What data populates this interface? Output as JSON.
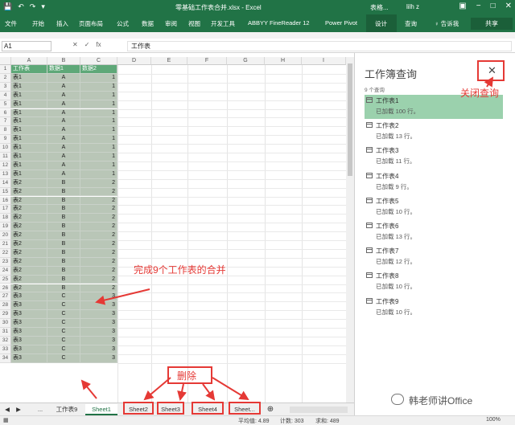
{
  "titlebar": {
    "qat": [
      "💾",
      "↶",
      "↷",
      "▾"
    ],
    "title": "零基础工作表合并.xlsx - Excel",
    "user": "lilh z",
    "context_label": "表格..."
  },
  "ribbon": {
    "tabs": [
      "文件",
      "开始",
      "插入",
      "页面布局",
      "公式",
      "数据",
      "审阅",
      "视图",
      "开发工具",
      "ABBYY FineReader 12",
      "Power Pivot",
      "设计",
      "查询",
      "♀ 告诉我",
      "共享"
    ]
  },
  "formula_bar": {
    "cell_ref": "A1",
    "icons": [
      "✕",
      "✓",
      "fx"
    ],
    "value": "工作表"
  },
  "columns": [
    "A",
    "B",
    "C",
    "D",
    "E",
    "F",
    "G",
    "H",
    "I"
  ],
  "table": {
    "headers": [
      "工作表",
      "数据1",
      "数据2"
    ],
    "rows": [
      [
        "表1",
        "A",
        "1"
      ],
      [
        "表1",
        "A",
        "1"
      ],
      [
        "表1",
        "A",
        "1"
      ],
      [
        "表1",
        "A",
        "1"
      ],
      [
        "表1",
        "A",
        "1"
      ],
      [
        "表1",
        "A",
        "1"
      ],
      [
        "表1",
        "A",
        "1"
      ],
      [
        "表1",
        "A",
        "1"
      ],
      [
        "表1",
        "A",
        "1"
      ],
      [
        "表1",
        "A",
        "1"
      ],
      [
        "表1",
        "A",
        "1"
      ],
      [
        "表1",
        "A",
        "1"
      ],
      [
        "表2",
        "B",
        "2"
      ],
      [
        "表2",
        "B",
        "2"
      ],
      [
        "表2",
        "B",
        "2"
      ],
      [
        "表2",
        "B",
        "2"
      ],
      [
        "表2",
        "B",
        "2"
      ],
      [
        "表2",
        "B",
        "2"
      ],
      [
        "表2",
        "B",
        "2"
      ],
      [
        "表2",
        "B",
        "2"
      ],
      [
        "表2",
        "B",
        "2"
      ],
      [
        "表2",
        "B",
        "2"
      ],
      [
        "表2",
        "B",
        "2"
      ],
      [
        "表2",
        "B",
        "2"
      ],
      [
        "表2",
        "B",
        "2"
      ],
      [
        "表3",
        "C",
        "3"
      ],
      [
        "表3",
        "C",
        "3"
      ],
      [
        "表3",
        "C",
        "3"
      ],
      [
        "表3",
        "C",
        "3"
      ],
      [
        "表3",
        "C",
        "3"
      ],
      [
        "表3",
        "C",
        "3"
      ],
      [
        "表3",
        "C",
        "3"
      ],
      [
        "表3",
        "C",
        "3"
      ]
    ]
  },
  "sheet_tabs": [
    "...",
    "工作表9",
    "Sheet1",
    "Sheet2",
    "Sheet3",
    "Sheet4",
    "Sheet..."
  ],
  "status_bar": {
    "average": "平均值: 4.89",
    "count": "计数: 303",
    "sum": "求和: 489",
    "zoom": "100%"
  },
  "query_pane": {
    "title": "工作簿查询",
    "count": "9 个查询",
    "close": "✕",
    "items": [
      {
        "name": "工作表1",
        "status": "已加载 100 行。"
      },
      {
        "name": "工作表2",
        "status": "已加载 13 行。"
      },
      {
        "name": "工作表3",
        "status": "已加载 11 行。"
      },
      {
        "name": "工作表4",
        "status": "已加载 9 行。"
      },
      {
        "name": "工作表5",
        "status": "已加载 10 行。"
      },
      {
        "name": "工作表6",
        "status": "已加载 13 行。"
      },
      {
        "name": "工作表7",
        "status": "已加载 12 行。"
      },
      {
        "name": "工作表8",
        "status": "已加载 10 行。"
      },
      {
        "name": "工作表9",
        "status": "已加载 10 行。"
      }
    ]
  },
  "annotations": {
    "close_query": "关闭查询",
    "merge_done": "完成9个工作表的合并",
    "delete": "删除"
  },
  "watermark": "韩老师讲Office",
  "colors": {
    "excel_green": "#217346",
    "annotation_red": "#e53935",
    "table_header": "#5ea878",
    "table_fill": "#b9c6b7",
    "selected_query": "#9bd1ad"
  }
}
